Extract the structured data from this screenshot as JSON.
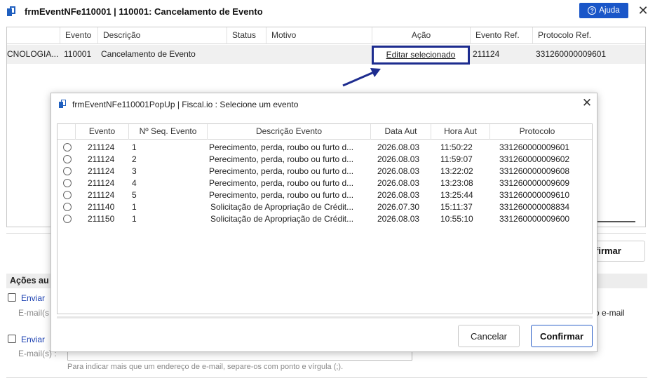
{
  "window": {
    "title": "frmEventNFe110001 | 110001: Cancelamento de Evento",
    "help_label": "Ajuda"
  },
  "main_grid": {
    "columns": [
      "Evento",
      "Descrição",
      "Status",
      "Motivo",
      "Ação",
      "Evento Ref.",
      "Protocolo Ref."
    ],
    "row": {
      "entity": "CNOLOGIA...",
      "evento": "110001",
      "descricao": "Cancelamento de Evento",
      "status": "",
      "motivo": "",
      "acao": "Editar selecionado",
      "evento_ref": "211124",
      "protocolo_ref": "331260000009601"
    }
  },
  "lower": {
    "confirm_partial": "firmar",
    "section_title": "Ações au",
    "send1": "Enviar",
    "email1": "E-mail(s",
    "email_right": "o e-mail",
    "send2": "Enviar",
    "email2": "E-mail(s) :",
    "hint": "Para indicar mais que um endereço de e-mail, separe-os com ponto e vírgula (;)."
  },
  "popup": {
    "title": "frmEventNFe110001PopUp | Fiscal.io : Selecione um evento",
    "columns": [
      "Evento",
      "Nº Seq. Evento",
      "Descrição Evento",
      "Data Aut",
      "Hora Aut",
      "Protocolo"
    ],
    "rows": [
      {
        "evento": "211124",
        "seq": "1",
        "descricao": "Perecimento, perda, roubo ou furto d...",
        "data": "2026.08.03",
        "hora": "11:50:22",
        "protocolo": "331260000009601"
      },
      {
        "evento": "211124",
        "seq": "2",
        "descricao": "Perecimento, perda, roubo ou furto d...",
        "data": "2026.08.03",
        "hora": "11:59:07",
        "protocolo": "331260000009602"
      },
      {
        "evento": "211124",
        "seq": "3",
        "descricao": "Perecimento, perda, roubo ou furto d...",
        "data": "2026.08.03",
        "hora": "13:22:02",
        "protocolo": "331260000009608"
      },
      {
        "evento": "211124",
        "seq": "4",
        "descricao": "Perecimento, perda, roubo ou furto d...",
        "data": "2026.08.03",
        "hora": "13:23:08",
        "protocolo": "331260000009609"
      },
      {
        "evento": "211124",
        "seq": "5",
        "descricao": "Perecimento, perda, roubo ou furto d...",
        "data": "2026.08.03",
        "hora": "13:25:44",
        "protocolo": "331260000009610"
      },
      {
        "evento": "211140",
        "seq": "1",
        "descricao": "Solicitação de Apropriação de Crédit...",
        "data": "2026.07.30",
        "hora": "15:11:37",
        "protocolo": "331260000008834"
      },
      {
        "evento": "211150",
        "seq": "1",
        "descricao": "Solicitação de Apropriação de Crédit...",
        "data": "2026.08.03",
        "hora": "10:55:10",
        "protocolo": "331260000009600"
      }
    ],
    "cancel_label": "Cancelar",
    "confirm_label": "Confirmar"
  }
}
